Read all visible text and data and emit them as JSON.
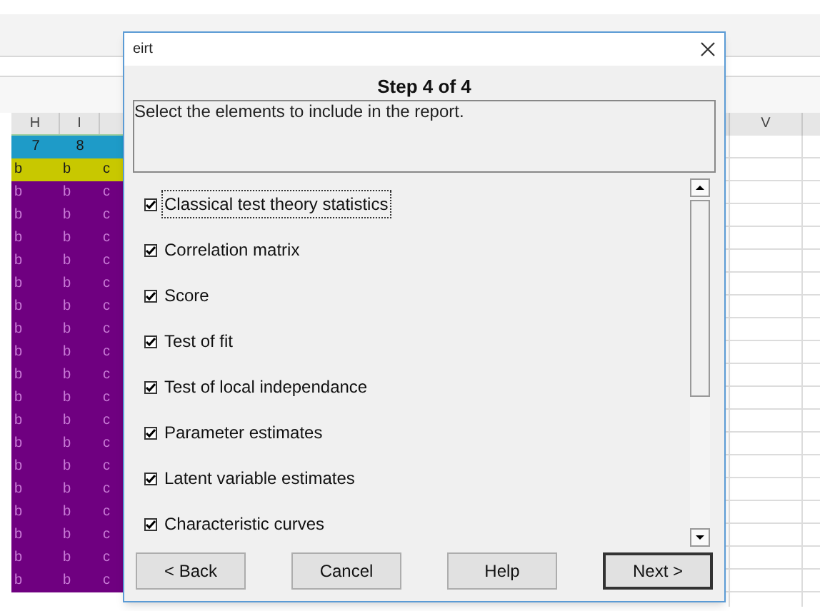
{
  "spreadsheet": {
    "left_columns": [
      "H",
      "I"
    ],
    "right_columns": [
      "V"
    ],
    "rows": [
      {
        "kind": "number",
        "cells": [
          "7",
          "8"
        ]
      },
      {
        "kind": "key",
        "cells": [
          "b",
          "b",
          "c"
        ]
      },
      {
        "kind": "data",
        "cells": [
          "b",
          "b",
          "c"
        ]
      },
      {
        "kind": "data",
        "cells": [
          "b",
          "b",
          "c"
        ]
      },
      {
        "kind": "data",
        "cells": [
          "b",
          "b",
          "c"
        ]
      },
      {
        "kind": "data",
        "cells": [
          "b",
          "b",
          "c"
        ]
      },
      {
        "kind": "data",
        "cells": [
          "b",
          "b",
          "c"
        ]
      },
      {
        "kind": "data",
        "cells": [
          "b",
          "b",
          "c"
        ]
      },
      {
        "kind": "data",
        "cells": [
          "b",
          "b",
          "c"
        ]
      },
      {
        "kind": "data",
        "cells": [
          "b",
          "b",
          "c"
        ]
      },
      {
        "kind": "data",
        "cells": [
          "b",
          "b",
          "c"
        ]
      },
      {
        "kind": "data",
        "cells": [
          "b",
          "b",
          "c"
        ]
      },
      {
        "kind": "data",
        "cells": [
          "b",
          "b",
          "c"
        ]
      },
      {
        "kind": "data",
        "cells": [
          "b",
          "b",
          "c"
        ]
      },
      {
        "kind": "data",
        "cells": [
          "b",
          "b",
          "c"
        ]
      },
      {
        "kind": "data",
        "cells": [
          "b",
          "b",
          "c"
        ]
      },
      {
        "kind": "data",
        "cells": [
          "b",
          "b",
          "c"
        ]
      },
      {
        "kind": "data",
        "cells": [
          "b",
          "b",
          "c"
        ]
      },
      {
        "kind": "data",
        "cells": [
          "b",
          "b",
          "c"
        ]
      },
      {
        "kind": "data",
        "cells": [
          "b",
          "b",
          "c"
        ]
      }
    ]
  },
  "window": {
    "title": "eirt"
  },
  "step": "Step 4 of 4",
  "instructions": "Select the elements to include in the report.",
  "options": [
    {
      "label": "Classical test theory statistics",
      "checked": true,
      "focused": true
    },
    {
      "label": "Correlation matrix",
      "checked": true,
      "focused": false
    },
    {
      "label": "Score",
      "checked": true,
      "focused": false
    },
    {
      "label": "Test of fit",
      "checked": true,
      "focused": false
    },
    {
      "label": "Test of local independance",
      "checked": true,
      "focused": false
    },
    {
      "label": "Parameter estimates",
      "checked": true,
      "focused": false
    },
    {
      "label": "Latent variable estimates",
      "checked": true,
      "focused": false
    },
    {
      "label": "Characteristic curves",
      "checked": true,
      "focused": false
    }
  ],
  "buttons": [
    {
      "label": "< Back",
      "default": false
    },
    {
      "label": "Cancel",
      "default": false
    },
    {
      "label": "Help",
      "default": false
    },
    {
      "label": "Next >",
      "default": true
    }
  ]
}
